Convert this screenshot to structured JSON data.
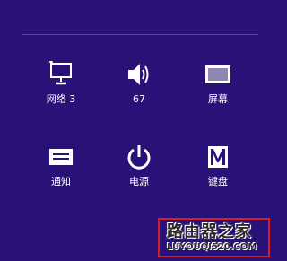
{
  "settings": {
    "tiles": [
      {
        "label": "网络 3",
        "icon": "network-icon"
      },
      {
        "label": "67",
        "icon": "volume-icon"
      },
      {
        "label": "屏幕",
        "icon": "screen-icon"
      },
      {
        "label": "通知",
        "icon": "notifications-icon"
      },
      {
        "label": "电源",
        "icon": "power-icon"
      },
      {
        "label": "键盘",
        "icon": "keyboard-icon"
      }
    ]
  },
  "watermark": {
    "title": "路由器之家",
    "url": "LUYOUQI520.COM"
  },
  "colors": {
    "background": "#2a1178",
    "foreground": "#ffffff",
    "watermark_border": "#d21f2b"
  }
}
